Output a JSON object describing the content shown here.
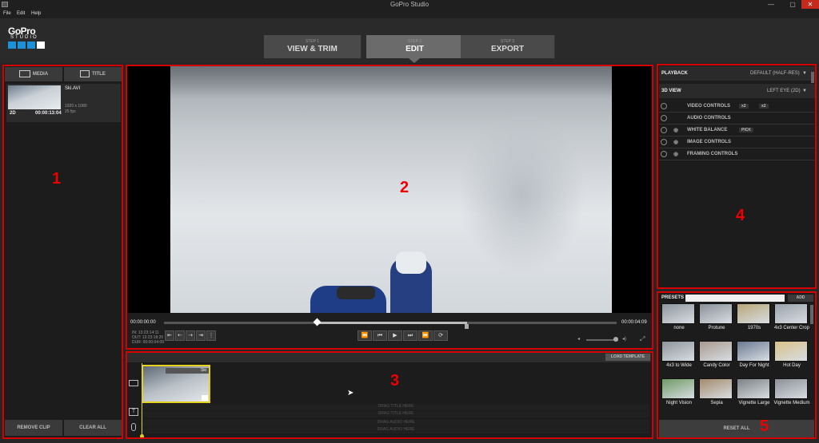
{
  "window": {
    "title": "GoPro Studio",
    "minimize": "—",
    "maximize": "▢",
    "close": "✕"
  },
  "menu": [
    "File",
    "Edit",
    "Help"
  ],
  "logo": {
    "main": "GoPro",
    "sub": "STUDIO"
  },
  "steps": [
    {
      "num": "STEP 1",
      "label": "VIEW & TRIM"
    },
    {
      "num": "STEP 2",
      "label": "EDIT"
    },
    {
      "num": "STEP 3",
      "label": "EXPORT"
    }
  ],
  "media_panel": {
    "tab_media": "MEDIA",
    "tab_title": "TITLE",
    "clip": {
      "name": "Ski.AVI",
      "res": "1920 x 1080",
      "fps": "25 fps",
      "mode": "2D",
      "duration": "00:00:13:04"
    },
    "remove_clip": "REMOVE CLIP",
    "clear_all": "CLEAR ALL"
  },
  "player": {
    "time_start": "00:00:00:00",
    "time_end": "00:00:04:09",
    "in_label": "IN: 13:23:14:11",
    "out_label": "OUT: 13:23:18:20",
    "dur_label": "DUR: 00:00:04:09"
  },
  "timeline": {
    "load_template": "LOAD TEMPLATE",
    "clip_label": "Ski",
    "drag_rows": [
      "DRAG TITLE HERE",
      "DRAG TITLE HERE",
      "DRAG AUDIO HERE",
      "DRAG AUDIO HERE"
    ]
  },
  "controls_panel": {
    "playback_label": "PLAYBACK",
    "playback_value": "DEFAULT (HALF-RES)",
    "view_label": "3D VIEW",
    "view_value": "LEFT EYE (2D)",
    "sections": [
      {
        "label": "VIDEO CONTROLS",
        "badge": "x2"
      },
      {
        "label": "AUDIO CONTROLS",
        "badge": ""
      },
      {
        "label": "WHITE BALANCE",
        "badge": "PICK"
      },
      {
        "label": "IMAGE CONTROLS",
        "badge": ""
      },
      {
        "label": "FRAMING CONTROLS",
        "badge": ""
      }
    ]
  },
  "presets": {
    "label": "PRESETS",
    "add": "ADD",
    "reset": "RESET ALL",
    "items": [
      {
        "name": "none",
        "color": "#8e959c"
      },
      {
        "name": "Protune",
        "color": "#8a9198"
      },
      {
        "name": "1970s",
        "color": "#b8a67a"
      },
      {
        "name": "4x3 Center Crop",
        "color": "#9aa2aa"
      },
      {
        "name": "4x3 to Wide",
        "color": "#8d949b"
      },
      {
        "name": "Candy Color",
        "color": "#a99a90"
      },
      {
        "name": "Day For Night",
        "color": "#6b7a92"
      },
      {
        "name": "Hot Day",
        "color": "#d8c08a"
      },
      {
        "name": "Night Vision",
        "color": "#6f9a64"
      },
      {
        "name": "Sepia",
        "color": "#a48b6c"
      },
      {
        "name": "Vignette Large",
        "color": "#7d8287"
      },
      {
        "name": "Vignette Medium",
        "color": "#8a9096"
      }
    ]
  },
  "region_numbers": [
    "1",
    "2",
    "3",
    "4",
    "5"
  ],
  "colors": {
    "accent": "#1e90d8",
    "highlight_box": "#d60000",
    "clip_border": "#e6d21e"
  }
}
